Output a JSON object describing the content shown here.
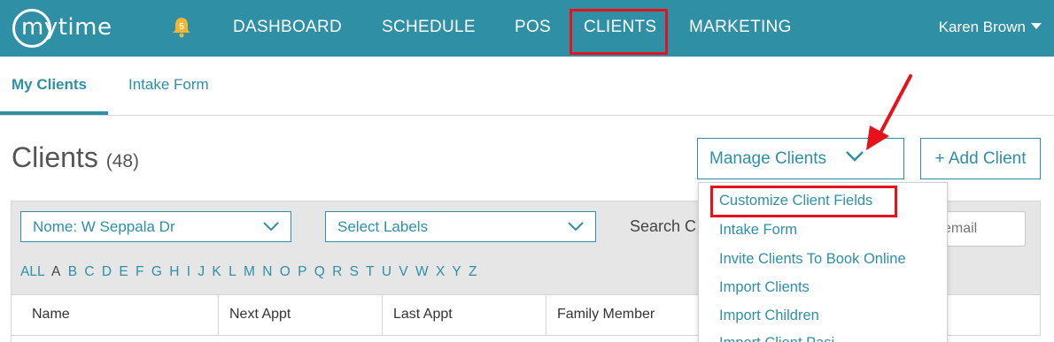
{
  "nav": {
    "logo": "mytime",
    "notification_count": "5",
    "items": [
      "DASHBOARD",
      "SCHEDULE",
      "POS",
      "CLIENTS",
      "MARKETING"
    ],
    "user_name": "Karen Brown"
  },
  "subtabs": [
    "My Clients",
    "Intake Form"
  ],
  "page": {
    "title": "Clients",
    "count": "(48)"
  },
  "actions": {
    "manage": "Manage Clients",
    "add": "+ Add Client"
  },
  "filters": {
    "location": "Nome: W Seppala Dr",
    "labels": "Select Labels",
    "search_label": "Search C",
    "search_placeholder": "email"
  },
  "alphabet": [
    "ALL",
    "A",
    "B",
    "C",
    "D",
    "E",
    "F",
    "G",
    "H",
    "I",
    "J",
    "K",
    "L",
    "M",
    "N",
    "O",
    "P",
    "Q",
    "R",
    "S",
    "T",
    "U",
    "V",
    "W",
    "X",
    "Y",
    "Z"
  ],
  "table": {
    "columns": [
      "Name",
      "Next Appt",
      "Last Appt",
      "Family Member"
    ]
  },
  "dropdown": {
    "items": [
      "Customize Client Fields",
      "Intake Form",
      "Invite Clients To Book Online",
      "Import Clients",
      "Import Children",
      "Import Client Pasi"
    ]
  },
  "colors": {
    "brand": "#2e8fa5",
    "highlight": "#e8101a",
    "bell": "#f2b632"
  }
}
